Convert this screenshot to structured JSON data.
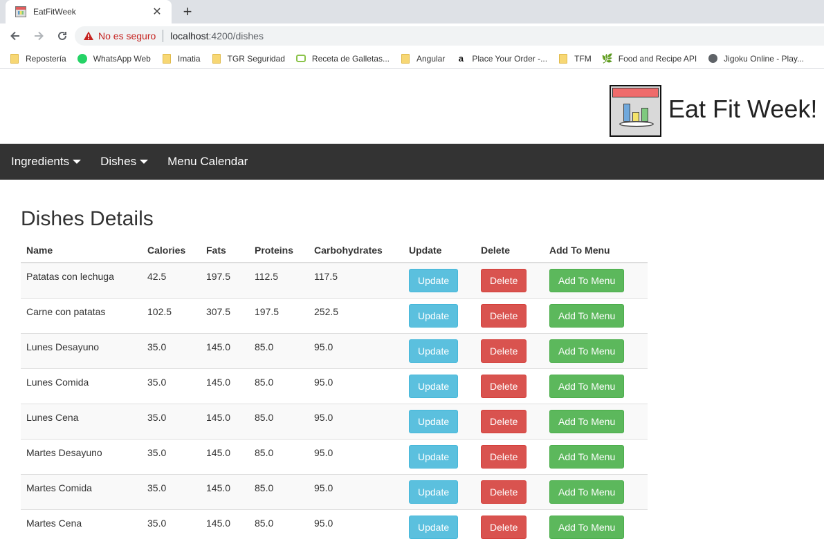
{
  "browser": {
    "tab_title": "EatFitWeek",
    "close_glyph": "✕",
    "new_tab_glyph": "+",
    "security_label": "No es seguro",
    "url_host": "localhost",
    "url_path": ":4200/dishes",
    "bookmarks": [
      {
        "label": "Repostería",
        "icon": "folder-icon"
      },
      {
        "label": "WhatsApp Web",
        "icon": "whatsapp-icon"
      },
      {
        "label": "Imatia",
        "icon": "folder-icon"
      },
      {
        "label": "TGR Seguridad",
        "icon": "folder-icon"
      },
      {
        "label": "Receta de Galletas...",
        "icon": "tv-icon"
      },
      {
        "label": "Angular",
        "icon": "folder-icon"
      },
      {
        "label": "Place Your Order -...",
        "icon": "amazon-icon"
      },
      {
        "label": "TFM",
        "icon": "folder-icon"
      },
      {
        "label": "Food and Recipe API",
        "icon": "leaf-icon"
      },
      {
        "label": "Jigoku Online - Play...",
        "icon": "globe-icon"
      }
    ]
  },
  "header": {
    "brand": "Eat Fit Week!"
  },
  "nav": {
    "ingredients": "Ingredients",
    "dishes": "Dishes",
    "menu_calendar": "Menu Calendar"
  },
  "main": {
    "title": "Dishes Details",
    "columns": [
      "Name",
      "Calories",
      "Fats",
      "Proteins",
      "Carbohydrates",
      "Update",
      "Delete",
      "Add To Menu"
    ],
    "buttons": {
      "update": "Update",
      "delete": "Delete",
      "add": "Add To Menu"
    },
    "rows": [
      {
        "name": "Patatas con lechuga",
        "calories": "42.5",
        "fats": "197.5",
        "proteins": "112.5",
        "carbs": "117.5"
      },
      {
        "name": "Carne con patatas",
        "calories": "102.5",
        "fats": "307.5",
        "proteins": "197.5",
        "carbs": "252.5"
      },
      {
        "name": "Lunes Desayuno",
        "calories": "35.0",
        "fats": "145.0",
        "proteins": "85.0",
        "carbs": "95.0"
      },
      {
        "name": "Lunes Comida",
        "calories": "35.0",
        "fats": "145.0",
        "proteins": "85.0",
        "carbs": "95.0"
      },
      {
        "name": "Lunes Cena",
        "calories": "35.0",
        "fats": "145.0",
        "proteins": "85.0",
        "carbs": "95.0"
      },
      {
        "name": "Martes Desayuno",
        "calories": "35.0",
        "fats": "145.0",
        "proteins": "85.0",
        "carbs": "95.0"
      },
      {
        "name": "Martes Comida",
        "calories": "35.0",
        "fats": "145.0",
        "proteins": "85.0",
        "carbs": "95.0"
      },
      {
        "name": "Martes Cena",
        "calories": "35.0",
        "fats": "145.0",
        "proteins": "85.0",
        "carbs": "95.0"
      }
    ]
  },
  "colors": {
    "navbar": "#333333",
    "update": "#5bc0de",
    "delete": "#d9534f",
    "add": "#5cb85c"
  }
}
